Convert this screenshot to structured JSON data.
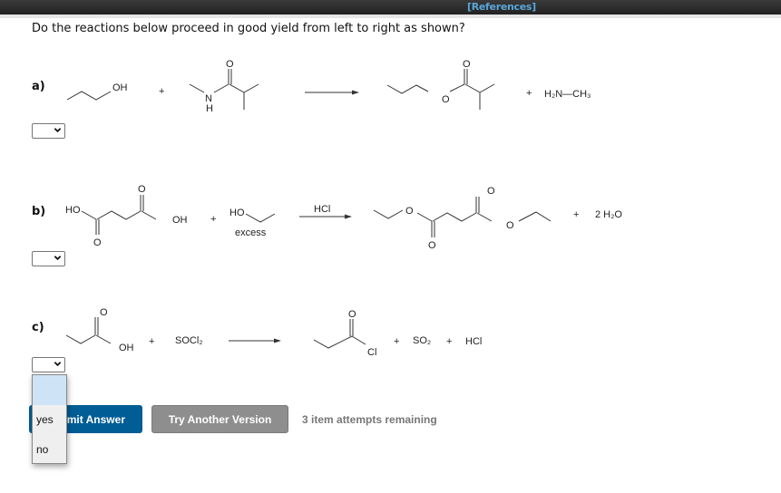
{
  "header": {
    "references_link": "[References]"
  },
  "question": "Do the reactions below proceed in good yield from left to right as shown?",
  "reactions": [
    {
      "label": "a)",
      "reactant1": {
        "name": "1-propanol",
        "atoms": {
          "oh": "OH"
        }
      },
      "plus1": "+",
      "reactant2": {
        "name": "N-methyl-2-methylpropanamide",
        "atoms": {
          "o": "O",
          "n": "N",
          "h": "H"
        }
      },
      "conditions": "",
      "product1": {
        "name": "propyl 2-methylpropanoate",
        "atoms": {
          "o_carbonyl": "O",
          "o_ester": "O"
        }
      },
      "plus2": "+",
      "byproduct": "H₂N—CH₃",
      "answer_select": {
        "value": "",
        "options": [
          "",
          "yes",
          "no"
        ]
      }
    },
    {
      "label": "b)",
      "reactant1": {
        "name": "succinic acid",
        "atoms": {
          "ho": "HO",
          "o1": "O",
          "o2": "O",
          "oh": "OH"
        }
      },
      "plus1": "+",
      "reactant2": {
        "name": "ethanol",
        "atoms": {
          "ho": "HO"
        },
        "note": "excess"
      },
      "conditions": "HCl",
      "product1": {
        "name": "diethyl succinate",
        "atoms": {
          "o1": "O",
          "o2": "O",
          "o3": "O",
          "o4": "O"
        }
      },
      "plus2": "+",
      "byproduct": "2 H₂O",
      "answer_select": {
        "value": "",
        "options": [
          "",
          "yes",
          "no"
        ]
      }
    },
    {
      "label": "c)",
      "reactant1": {
        "name": "propanoic acid",
        "atoms": {
          "o": "O",
          "oh": "OH"
        }
      },
      "plus1": "+",
      "reactant2": {
        "name": "SOCl₂"
      },
      "conditions": "",
      "product1": {
        "name": "propanoyl chloride",
        "atoms": {
          "o": "O",
          "cl": "Cl"
        }
      },
      "plus2": "+",
      "byproduct1": "SO₂",
      "plus3": "+",
      "byproduct2": "HCl",
      "answer_select": {
        "value": "",
        "open": true,
        "options": [
          "",
          "yes",
          "no"
        ]
      }
    }
  ],
  "dropdown_options": {
    "blank": "",
    "yes": "yes",
    "no": "no"
  },
  "buttons": {
    "submit": "Submit Answer",
    "submit_visible": "mit Answer",
    "try_another": "Try Another Version"
  },
  "attempts_text": "3 item attempts remaining",
  "colors": {
    "submit_bg": "#005d96",
    "try_bg": "#8e8e8e",
    "references_link": "#5aa6d9",
    "dropdown_highlight": "#cfe3f7"
  }
}
